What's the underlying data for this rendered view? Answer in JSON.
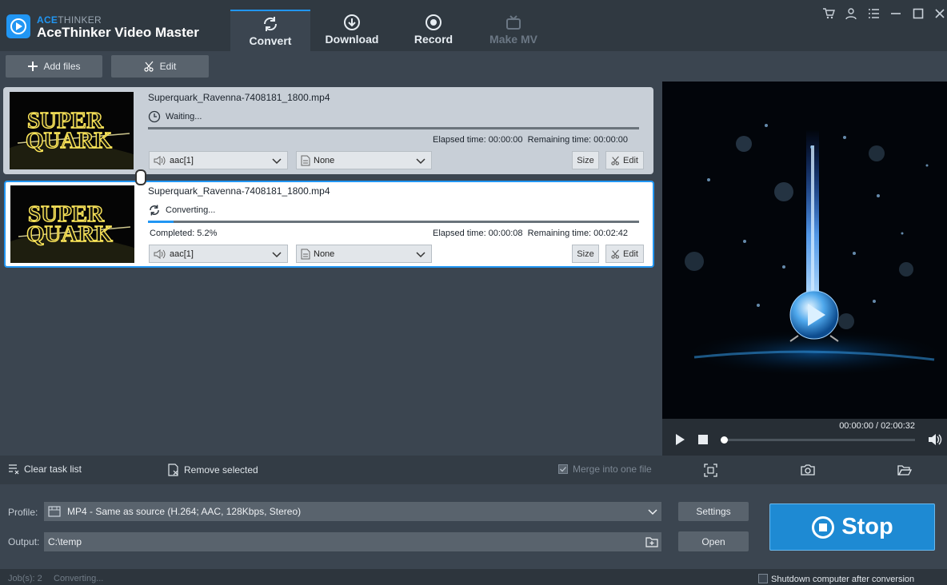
{
  "app": {
    "brand_prefix": "ACE",
    "brand_suffix": "THINKER",
    "title": "AceThinker Video Master"
  },
  "tabs": [
    {
      "label": "Convert",
      "active": true,
      "icon": "refresh-icon"
    },
    {
      "label": "Download",
      "active": false,
      "icon": "download-icon"
    },
    {
      "label": "Record",
      "active": false,
      "icon": "record-icon"
    },
    {
      "label": "Make MV",
      "active": false,
      "disabled": true,
      "icon": "tv-icon"
    }
  ],
  "window_controls": [
    "cart-icon",
    "user-icon",
    "menu-icon",
    "minimize-icon",
    "maximize-icon",
    "close-icon"
  ],
  "toolbar": {
    "add_files": "Add files",
    "edit": "Edit"
  },
  "tasks": [
    {
      "thumbnail_text": [
        "SUPER",
        "QUARK"
      ],
      "filename": "Superquark_Ravenna-7408181_1800.mp4",
      "status": "Waiting...",
      "progress": 0,
      "completed": "",
      "elapsed": "Elapsed time: 00:00:00",
      "remaining": "Remaining time: 00:00:00",
      "audio": "aac[1]",
      "subtitle": "None",
      "size_label": "Size",
      "edit_label": "Edit",
      "selected": false
    },
    {
      "thumbnail_text": [
        "SUPER",
        "QUARK"
      ],
      "filename": "Superquark_Ravenna-7408181_1800.mp4",
      "status": "Converting...",
      "progress": 0.052,
      "completed": "Completed: 5.2%",
      "elapsed": "Elapsed time: 00:00:08",
      "remaining": "Remaining time: 00:02:42",
      "audio": "aac[1]",
      "subtitle": "None",
      "size_label": "Size",
      "edit_label": "Edit",
      "selected": true
    }
  ],
  "player": {
    "time": "00:00:00 / 02:00:32",
    "position": 0
  },
  "bottom": {
    "clear": "Clear task list",
    "remove": "Remove selected",
    "merge": "Merge into one file",
    "merge_checked": true
  },
  "profile": {
    "label": "Profile:",
    "value": "MP4 - Same as source (H.264; AAC, 128Kbps, Stereo)",
    "settings_button": "Settings"
  },
  "output": {
    "label": "Output:",
    "value": "C:\\temp",
    "open_button": "Open"
  },
  "stop_button": "Stop",
  "status": {
    "jobs": "Job(s): 2",
    "state": "Converting...",
    "shutdown": "Shutdown computer after conversion"
  },
  "colors": {
    "accent": "#2196f3",
    "background": "#3b4550",
    "topbar": "#303941"
  }
}
